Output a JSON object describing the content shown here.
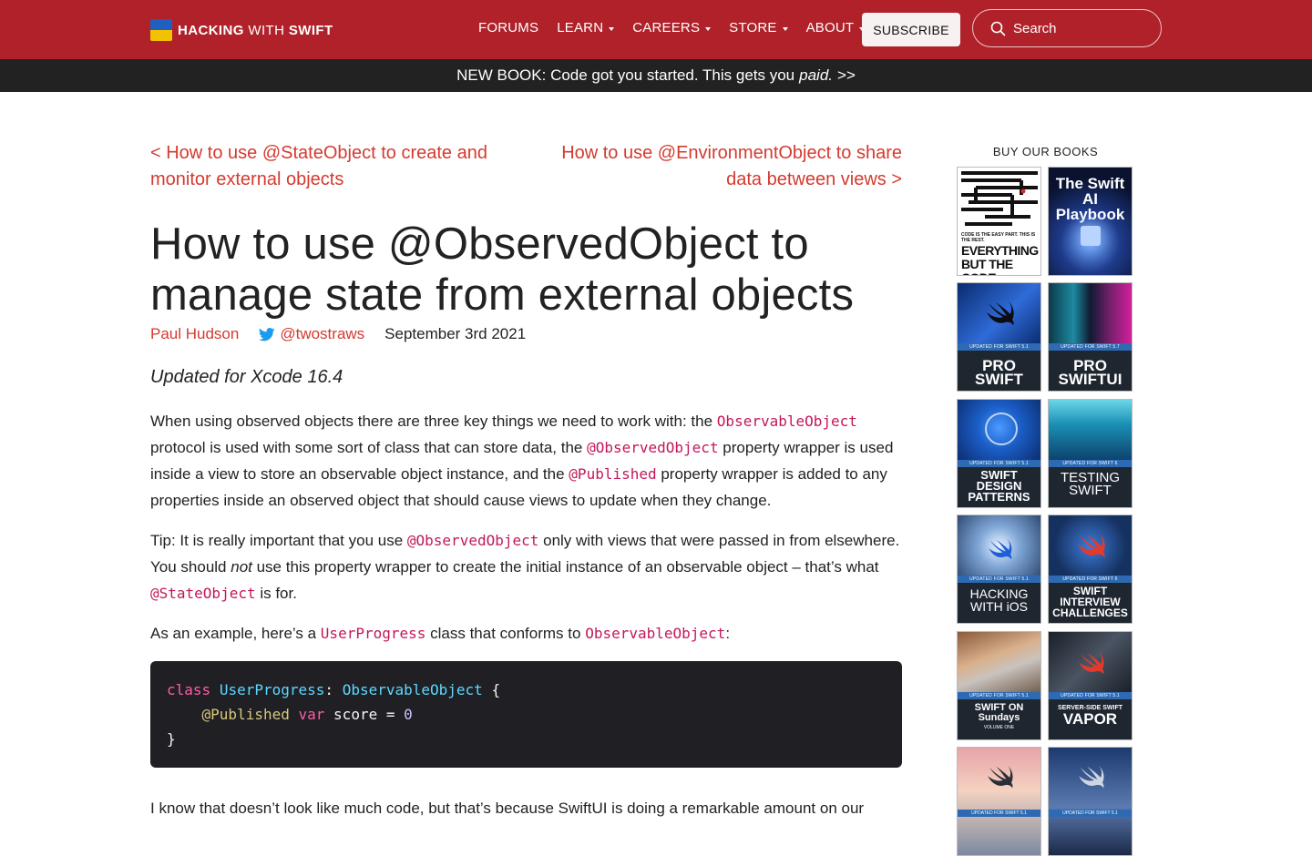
{
  "header": {
    "logo_bold_1": "HACKING",
    "logo_light": "WITH",
    "logo_bold_2": "SWIFT",
    "nav": [
      {
        "label": "FORUMS",
        "dropdown": false
      },
      {
        "label": "LEARN",
        "dropdown": true
      },
      {
        "label": "CAREERS",
        "dropdown": true
      },
      {
        "label": "STORE",
        "dropdown": true
      },
      {
        "label": "ABOUT",
        "dropdown": true
      }
    ],
    "subscribe_label": "SUBSCRIBE",
    "search_placeholder": "Search"
  },
  "banner": {
    "text": "NEW BOOK: Code got you started. This gets you",
    "emphasis": "paid.",
    "arrow": ">>"
  },
  "article": {
    "prev_link": "< How to use @StateObject to create and monitor external objects",
    "next_link": "How to use @EnvironmentObject to share data between views >",
    "title": "How to use @ObservedObject to manage state from external objects",
    "author": "Paul Hudson",
    "twitter": "@twostraws",
    "date": "September 3rd 2021",
    "updated": "Updated for Xcode 16.4",
    "p1": {
      "t1": "When using observed objects there are three key things we need to work with: the ",
      "c1": "ObservableObject",
      "t2": " protocol is used with some sort of class that can store data, the ",
      "c2": "@ObservedObject",
      "t3": " property wrapper is used inside a view to store an observable object instance, and the ",
      "c3": "@Published",
      "t4": " property wrapper is added to any properties inside an observed object that should cause views to update when they change."
    },
    "p2": {
      "t1": "Tip: It is really important that you use ",
      "c1": "@ObservedObject",
      "t2": " only with views that were passed in from elsewhere. You should ",
      "em": "not",
      "t3": " use this property wrapper to create the initial instance of an observable object – that’s what ",
      "c2": "@StateObject",
      "t4": " is for."
    },
    "p3": {
      "t1": "As an example, here’s a ",
      "c1": "UserProgress",
      "t2": " class that conforms to ",
      "c2": "ObservableObject",
      "t3": ":"
    },
    "code": {
      "l1_kw": "class",
      "l1_type": "UserProgress",
      "l1_colon": ":",
      "l1_proto": "ObservableObject",
      "l1_brace": "{",
      "l2_attr": "@Published",
      "l2_kw": "var",
      "l2_name": "score",
      "l2_eq": "=",
      "l2_num": "0",
      "l3": "}"
    },
    "p4": "I know that doesn’t look like much code, but that’s because SwiftUI is doing a remarkable amount on our"
  },
  "sidebar": {
    "title": "BUY OUR BOOKS",
    "books": [
      {
        "label": "EVERYTHING BUT THE CODE",
        "tagline": "CODE IS THE EASY PART. THIS IS THE REST."
      },
      {
        "label": "The Swift AI Playbook"
      },
      {
        "label": "PRO SWIFT",
        "updated": "UPDATED FOR SWIFT 5.1"
      },
      {
        "label": "PRO SWIFTUI",
        "updated": "UPDATED FOR SWIFT 5.7"
      },
      {
        "label": "SWIFT DESIGN PATTERNS",
        "updated": "UPDATED FOR SWIFT 5.1"
      },
      {
        "label": "TESTING SWIFT",
        "updated": "UPDATED FOR SWIFT 6"
      },
      {
        "label": "HACKING WITH iOS",
        "updated": "UPDATED FOR SWIFT 5.1"
      },
      {
        "label": "SWIFT INTERVIEW CHALLENGES",
        "updated": "UPDATED FOR SWIFT 6"
      },
      {
        "label": "SWIFT ON Sundays",
        "subtitle": "VOLUME ONE",
        "updated": "UPDATED FOR SWIFT 5.1"
      },
      {
        "label": "VAPOR",
        "subtitle": "SERVER-SIDE SWIFT",
        "updated": "UPDATED FOR SWIFT 5.1"
      },
      {
        "updated": "UPDATED FOR SWIFT 5.1"
      },
      {
        "updated": "UPDATED FOR SWIFT 5.1"
      }
    ]
  },
  "colors": {
    "header_bg": "#b0212a",
    "banner_bg": "#222222",
    "link": "#d43a2f",
    "code_inline": "#c2185b",
    "code_bg": "#1f1f24"
  }
}
